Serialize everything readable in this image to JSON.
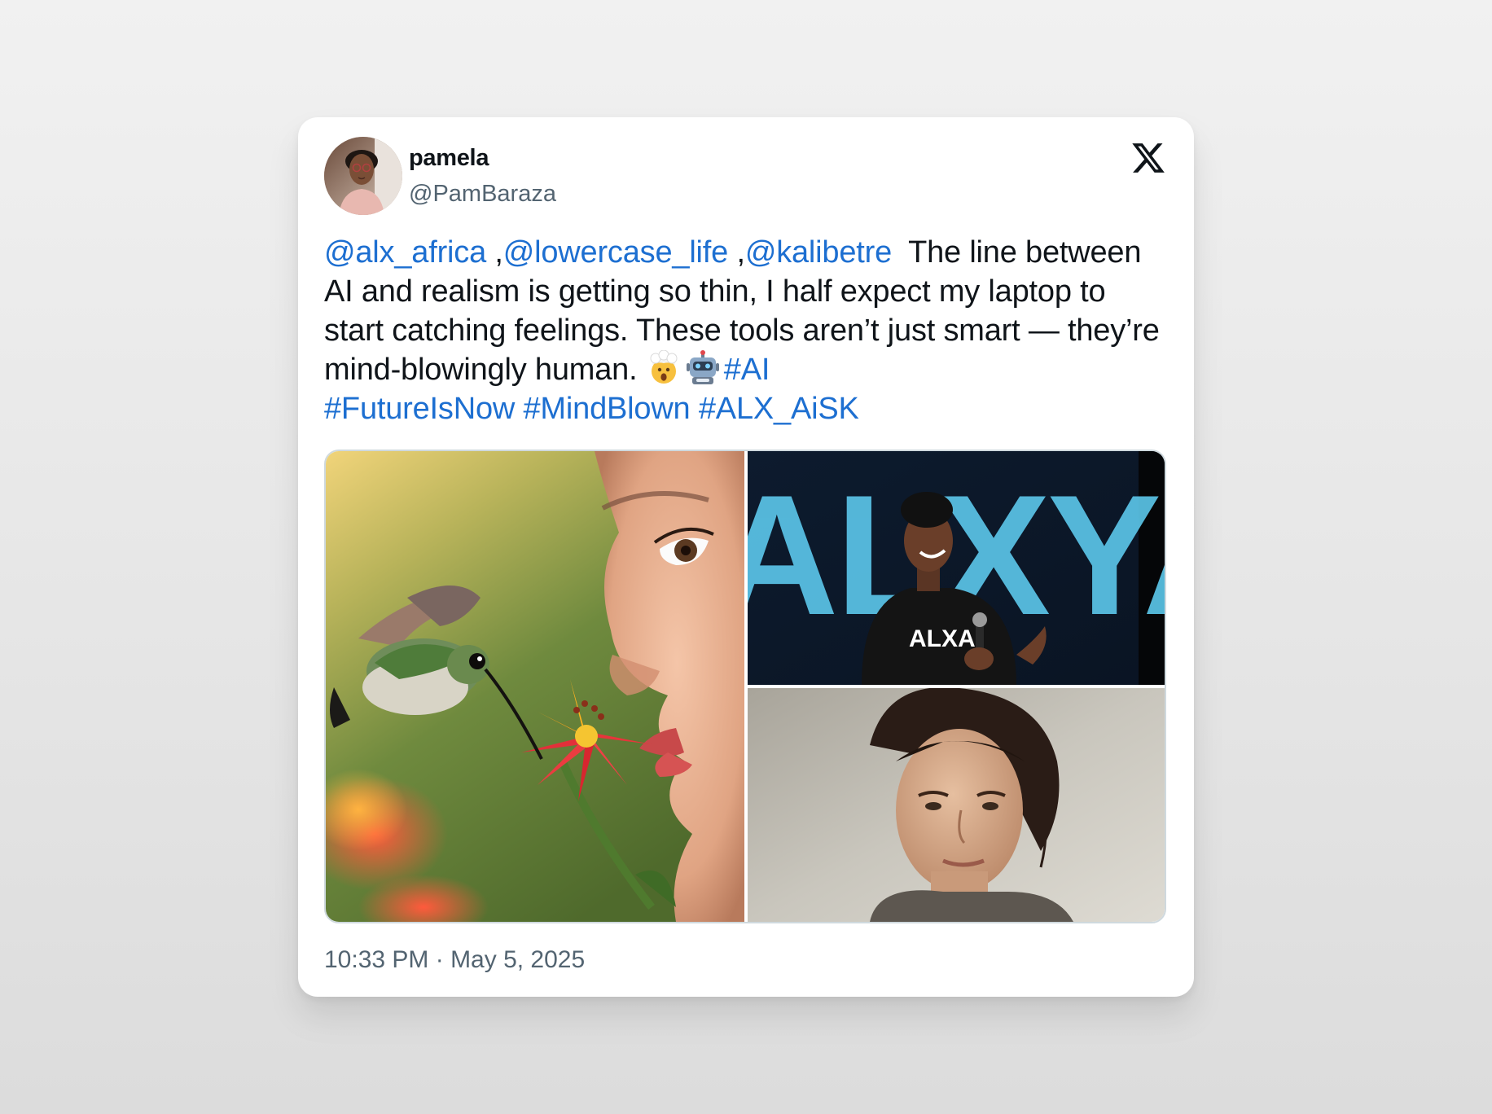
{
  "author": {
    "name": "pamela",
    "handle": "@PamBaraza"
  },
  "tweet": {
    "mention_1": "@alx_africa",
    "sep_1": " ,",
    "mention_2": "@lowercase_life",
    "sep_2": " ,",
    "mention_3": "@kalibetre",
    "body": "  The line between AI and realism is getting so thin, I half expect my laptop to start catching feelings. These tools aren’t just smart — they’re mind-blowingly human. ",
    "emojis": [
      "exploding-head-emoji",
      "robot-emoji"
    ],
    "hashtags": [
      "#AI",
      "#FutureIsNow",
      "#MindBlown",
      "#ALX_AiSK"
    ]
  },
  "media": {
    "speaker_photo_text": {
      "backdrop": "ALXYA",
      "shirt": "ALXAI"
    }
  },
  "timestamp": "10:33 PM · May 5, 2025",
  "colors": {
    "link": "#1d6fd1",
    "text": "#0f1419",
    "secondary": "#536471"
  }
}
